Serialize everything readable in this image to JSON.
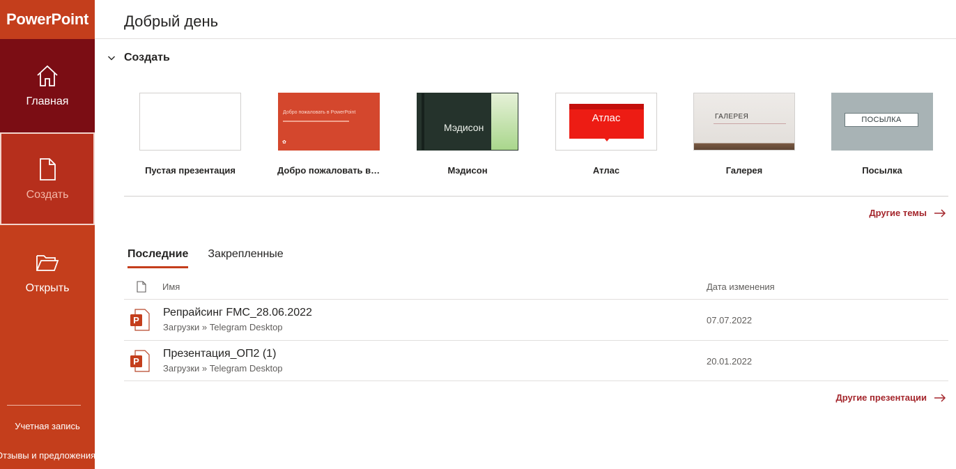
{
  "app": {
    "name": "PowerPoint",
    "brand_color": "#c43e1c"
  },
  "sidebar": {
    "items": [
      {
        "label": "Главная",
        "icon": "home-icon"
      },
      {
        "label": "Создать",
        "icon": "new-document-icon"
      },
      {
        "label": "Открыть",
        "icon": "open-folder-icon"
      }
    ],
    "account": "Учетная запись",
    "feedback": "Отзывы и предложения"
  },
  "main": {
    "greeting": "Добрый день",
    "create_section": "Создать",
    "templates": [
      {
        "label": "Пустая презентация"
      },
      {
        "label": "Добро пожаловать в Pow...",
        "thumb_text": "Добро пожаловать в PowerPoint"
      },
      {
        "label": "Мэдисон",
        "thumb_text": "Мэдисон"
      },
      {
        "label": "Атлас",
        "thumb_text": "Атлас"
      },
      {
        "label": "Галерея",
        "thumb_text": "ГАЛЕРЕЯ"
      },
      {
        "label": "Посылка",
        "thumb_text": "ПОСЫЛКА"
      }
    ],
    "more_themes": "Другие темы",
    "tabs": [
      {
        "label": "Последние",
        "active": true
      },
      {
        "label": "Закрепленные",
        "active": false
      }
    ],
    "table": {
      "col_name": "Имя",
      "col_date": "Дата изменения",
      "rows": [
        {
          "name": "Репрайсинг FMC_28.06.2022",
          "path": "Загрузки » Telegram Desktop",
          "date": "07.07.2022"
        },
        {
          "name": "Презентация_ОП2 (1)",
          "path": "Загрузки » Telegram Desktop",
          "date": "20.01.2022"
        }
      ]
    },
    "more_presentations": "Другие презентации"
  }
}
